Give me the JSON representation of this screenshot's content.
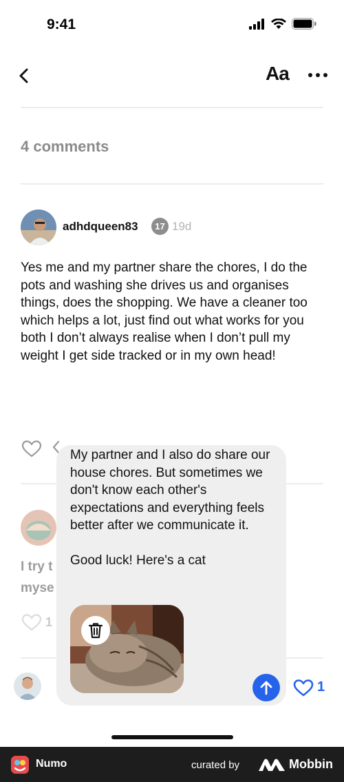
{
  "status_bar": {
    "time": "9:41"
  },
  "nav": {
    "font_label": "Aa"
  },
  "comments": {
    "count_label": "4 comments",
    "items": [
      {
        "username": "adhdqueen83",
        "badge": "17",
        "time_ago": "19d",
        "text": "Yes me and my partner share the chores, I do the pots and washing she drives us and organises things, does the shopping. We have a cleaner too which helps a lot, just find out what works for you both I don’t always realise when I don’t pull my weight I get side tracked or in my own head!"
      },
      {
        "text_partial_1": "I try t",
        "text_partial_2": "myse"
      }
    ]
  },
  "reply": {
    "text": "My partner and I also do share our house chores. But sometimes we don't know each other's expectations and everything feels better after we communicate it.\n\nGood luck! Here's a cat",
    "attachment_icon": "trash-icon",
    "send_icon": "arrow-up-icon"
  },
  "footer_like_count": "1",
  "partial_like_count": "1",
  "footer": {
    "app_name": "Numo",
    "curated_by": "curated by",
    "brand": "Mobbin"
  },
  "colors": {
    "accent": "#2563eb",
    "muted": "#8b8b8b",
    "popup_bg": "#efefef",
    "footer_bg": "#1d1d1d"
  }
}
